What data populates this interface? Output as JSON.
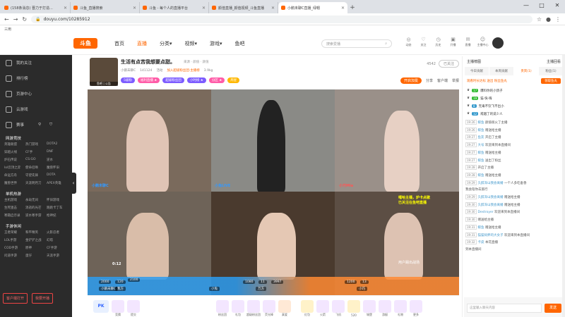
{
  "browser": {
    "tabs": [
      {
        "label": "(158条消息) 晋力于打造..."
      },
      {
        "label": "斗鱼_直播搜索"
      },
      {
        "label": "斗鱼 - 每个人的直播平台"
      },
      {
        "label": "颜值直播_颜值视频_斗鱼直播"
      },
      {
        "label": "小鹅未聊C直播_绿帽 "
      }
    ],
    "new_tab": "+",
    "window_controls": [
      "—",
      "□",
      "✕"
    ],
    "url": "douyu.com/10285912",
    "bookmark": "三用"
  },
  "header": {
    "logo": "斗鱼",
    "nav": [
      "首页",
      "直播",
      "分类▾",
      "视频▾",
      "游戏▾",
      "鱼吧"
    ],
    "search_placeholder": "搜索爱播",
    "icons": [
      {
        "name": "news",
        "label": "动态"
      },
      {
        "name": "follow",
        "label": "关注"
      },
      {
        "name": "history",
        "label": "历史"
      },
      {
        "name": "message",
        "label": "开播"
      },
      {
        "name": "upload",
        "label": "直播"
      },
      {
        "name": "game",
        "label": "主播中心"
      },
      {
        "name": "client",
        "label": "客户端"
      }
    ]
  },
  "sidebar": {
    "top": [
      "我的关注",
      "排行榜",
      "页游中心",
      "云游戏"
    ],
    "quick": [
      "赛事",
      "",
      ""
    ],
    "sections": [
      {
        "title": "网游竞技",
        "items": [
          "英雄联盟",
          "热门游戏",
          "DOTA2",
          "穿越火线",
          "CF手",
          "DNF",
          "炉石传说",
          "CS:GO",
          "逆水",
          "lol云顶之弈",
          "使命召唤",
          "魔兽怀旧",
          "命运方舟",
          "守望先锋",
          "DOTA",
          "魔兽世界",
          "天涯明月刀",
          "APEX英雄"
        ]
      },
      {
        "title": "单机热游",
        "items": [
          "主机游戏",
          "永劫无间",
          "怀旧游戏",
          "生死狙击",
          "消逝的光芒",
          "跑跑卡丁车",
          "寒霜启示录",
          "逆水寒手游",
          "枪神纪"
        ]
      },
      {
        "title": "手游休闲",
        "items": [
          "王者荣耀",
          "和平精英",
          "火影忍者",
          "LOL手游",
          "金铲铲之战",
          "幻塔",
          "COD手游",
          "原神",
          "CF手游",
          "问道手游",
          "蛋仔",
          "天涯手游"
        ]
      }
    ],
    "buttons": [
      "客户端打开",
      "我要开播"
    ]
  },
  "room": {
    "avatar_label": "鱼吧 | 公告",
    "title": "生活有点苦我想要点甜。",
    "category": "來源 · 颜值 · 颜值",
    "meta": [
      "小鹅未聊C",
      "141124",
      "活动",
      "加入超级粉丝团·主播榜"
    ],
    "fans": "3.9kg",
    "tags": [
      "5级粉",
      "福利直播 ★",
      "超级粉丝团",
      "小时榜 ★",
      "分区 ★",
      "周星"
    ],
    "report_count": "4542",
    "follow_btn": "已关注",
    "promo": "开启加冕",
    "tools": [
      "分享",
      "客户端",
      "举报"
    ]
  },
  "video": {
    "cell_labels": [
      "小鹅未聊C",
      "小兔LIVE",
      "小巧Mia",
      "用户踢出战场"
    ],
    "overlay_text": "嘻哈主播，炉卡点歌\n已关注在鱼吧直播",
    "bar_scores": [
      "2000",
      "120",
      "2100",
      "1080",
      "11",
      "3997",
      "1200",
      "13"
    ],
    "bar_names": [
      "小鹅未聊C",
      "我方",
      "小兔",
      "万方",
      "小巧"
    ],
    "timer": "0:12"
  },
  "giftbar": {
    "pk": "PK",
    "items": [
      "竞猜",
      "提交",
      "粉丝团",
      "礼包",
      "超级粉丝团",
      "荧光棒",
      "真爱",
      "红包",
      "火箭",
      "飞机",
      "520",
      "城堡",
      "游艇",
      "礼物",
      "更多"
    ]
  },
  "right_panel": {
    "title_left": "主播榜图",
    "title_right": "主播回看",
    "tabs": [
      "今日贡献",
      "本周贡献",
      "贵宾(1)",
      "粉丝(1)"
    ],
    "sub_left": "观看时长达标 送出 粉丝鱼丸",
    "sub_btn": "领取鱼丸",
    "rank": [
      {
        "lv": "17",
        "name": "爆料你的小鸽子"
      },
      {
        "lv": "19",
        "name": "猫·快·嗨"
      },
      {
        "lv": "8",
        "name": "无毒不饮飞不出小"
      },
      {
        "lv": "12",
        "name": "戒烟了的说少人"
      }
    ],
    "chat": [
      {
        "t": "19:26",
        "name": "鲸鱼",
        "text": "颜值很火了主播"
      },
      {
        "t": "19:26",
        "name": "鲸鱼",
        "text": "赠送给主播"
      },
      {
        "t": "19:27",
        "name": "鱼友",
        "text": "开启了主播"
      },
      {
        "t": "19:27",
        "name": "大号",
        "text": "欢迎来到本直播间"
      },
      {
        "t": "19:27",
        "name": "鲸鱼",
        "text": "赠送给主播"
      },
      {
        "t": "19:27",
        "name": "鲸鱼",
        "text": "送出了粉丝"
      },
      {
        "t": "19:28",
        "name": "",
        "text": "开启了主播"
      },
      {
        "t": "19:28",
        "name": "鲸鱼",
        "text": "赠送给主播"
      },
      {
        "t": "19:29",
        "name": "久醉深山我会离婚",
        "text": "一个人多吃垂香"
      },
      {
        "t": "",
        "name": "",
        "text": "我会陪你去旅行"
      },
      {
        "t": "19:29",
        "name": "久醉深山我会离婚",
        "text": "赠送给主播"
      },
      {
        "t": "19:30",
        "name": "久醉深山我会离婚",
        "text": "赠送给主播"
      },
      {
        "t": "19:30",
        "name": "Destroyer",
        "text": "欢迎来到本直播间"
      },
      {
        "t": "19:30",
        "name": "",
        "text": "赠送给主播"
      },
      {
        "t": "19:31",
        "name": "鲸鱼",
        "text": "赠送给主播"
      },
      {
        "t": "19:31",
        "name": "猫猫饲养的大女子",
        "text": "欢迎来到本直播间"
      },
      {
        "t": "19:32",
        "name": "卡皮",
        "text": "本花直播"
      },
      {
        "t": "",
        "name": "",
        "text": "到本直播间"
      }
    ],
    "input_placeholder": "这里输入聊天内容",
    "send": "发送"
  }
}
